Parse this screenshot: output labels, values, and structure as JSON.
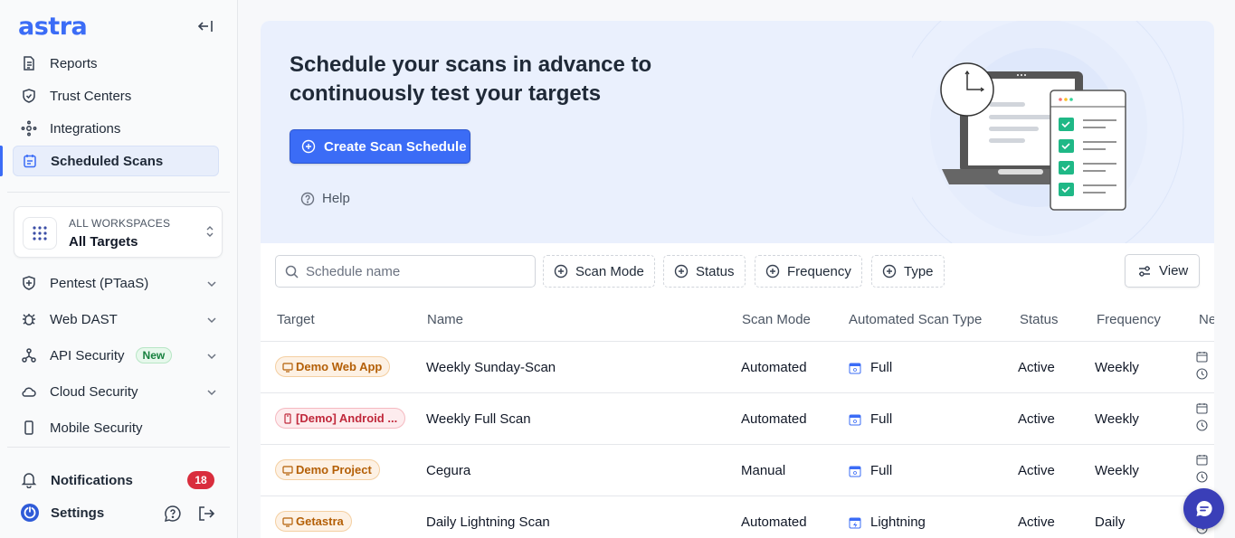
{
  "sidebar": {
    "logo": "astra",
    "nav": [
      {
        "label": "Reports",
        "icon": "document-icon"
      },
      {
        "label": "Trust Centers",
        "icon": "shield-check-icon"
      },
      {
        "label": "Integrations",
        "icon": "integrations-icon"
      },
      {
        "label": "Scheduled Scans",
        "icon": "calendar-icon",
        "active": true
      }
    ],
    "workspace": {
      "sub": "ALL WORKSPACES",
      "main": "All Targets"
    },
    "groups": [
      {
        "label": "Pentest (PTaaS)"
      },
      {
        "label": "Web DAST"
      },
      {
        "label": "API Security",
        "badge": "New"
      },
      {
        "label": "Cloud Security"
      },
      {
        "label": "Mobile Security"
      }
    ],
    "notifications": {
      "label": "Notifications",
      "count": "18"
    },
    "settings": {
      "label": "Settings"
    }
  },
  "hero": {
    "title": "Schedule your scans in advance to continuously test your targets",
    "create_label": "Create Scan Schedule",
    "help_label": "Help"
  },
  "toolbar": {
    "search_placeholder": "Schedule name",
    "filters": [
      "Scan Mode",
      "Status",
      "Frequency",
      "Type"
    ],
    "view_label": "View"
  },
  "table": {
    "headers": [
      "Target",
      "Name",
      "Scan Mode",
      "Automated Scan Type",
      "Status",
      "Frequency",
      "Ne"
    ],
    "rows": [
      {
        "target": "Demo Web App",
        "target_kind": "web",
        "name": "Weekly Sunday-Scan",
        "mode": "Automated",
        "type": "Full",
        "status": "Active",
        "frequency": "Weekly"
      },
      {
        "target": "[Demo] Android ...",
        "target_kind": "mobile",
        "name": "Weekly Full Scan",
        "mode": "Automated",
        "type": "Full",
        "status": "Active",
        "frequency": "Weekly"
      },
      {
        "target": "Demo Project",
        "target_kind": "web",
        "name": "Cegura",
        "mode": "Manual",
        "type": "Full",
        "status": "Active",
        "frequency": "Weekly"
      },
      {
        "target": "Getastra",
        "target_kind": "web",
        "name": "Daily Lightning Scan",
        "mode": "Automated",
        "type": "Lightning",
        "status": "Active",
        "frequency": "Daily"
      }
    ]
  },
  "colors": {
    "accent": "#3b6cf6",
    "hero_bg": "#eaf0fd",
    "badge_red": "#d92d3d",
    "chat": "#3a3fb8"
  }
}
